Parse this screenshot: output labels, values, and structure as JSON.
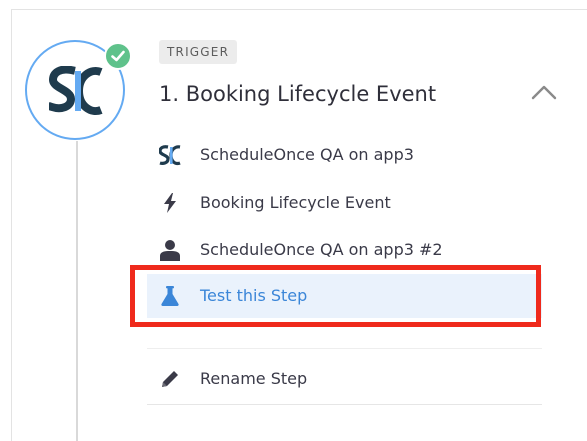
{
  "step": {
    "badge": "TRIGGER",
    "title": "1. Booking Lifecycle Event",
    "status": "complete",
    "app_logo_text": "SC"
  },
  "details": [
    {
      "icon": "scheduleonce-icon",
      "label": "ScheduleOnce QA on app3"
    },
    {
      "icon": "lightning-icon",
      "label": "Booking Lifecycle Event"
    },
    {
      "icon": "user-icon",
      "label": "ScheduleOnce QA on app3 #2"
    }
  ],
  "actions": {
    "test": {
      "icon": "flask-icon",
      "label": "Test this Step"
    },
    "rename": {
      "icon": "pencil-icon",
      "label": "Rename Step"
    }
  },
  "colors": {
    "accent": "#3b86d8",
    "success": "#5fc28b",
    "highlight": "#ef2a1c",
    "logo_dark": "#1f3b4d",
    "logo_blue": "#64aaf2"
  }
}
